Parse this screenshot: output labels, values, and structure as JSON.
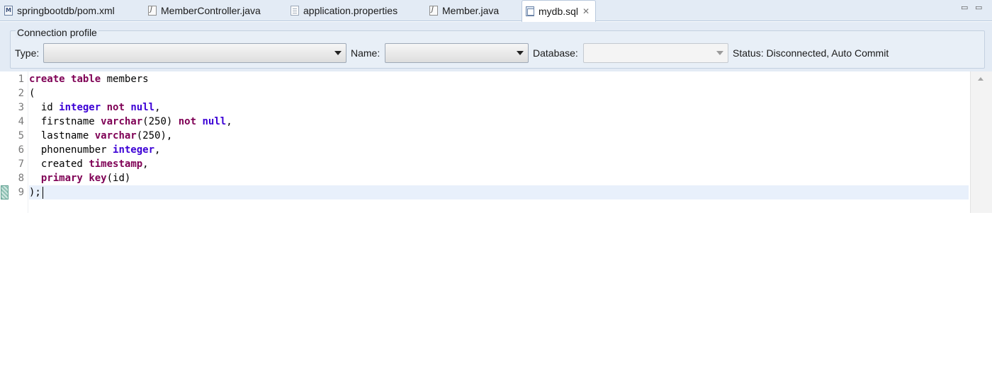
{
  "tabs": [
    {
      "label": "springbootdb/pom.xml",
      "icon": "maven-pom-icon"
    },
    {
      "label": "MemberController.java",
      "icon": "java-file-icon"
    },
    {
      "label": "application.properties",
      "icon": "properties-file-icon"
    },
    {
      "label": "Member.java",
      "icon": "java-file-icon"
    },
    {
      "label": "mydb.sql",
      "icon": "sql-file-icon",
      "active": true,
      "close": "✕"
    }
  ],
  "window_controls": {
    "minimize": "▭",
    "maximize": "▭"
  },
  "connection_profile": {
    "legend": "Connection profile",
    "type_label": "Type:",
    "type_value": "",
    "name_label": "Name:",
    "name_value": "",
    "database_label": "Database:",
    "database_value": "",
    "status": "Status: Disconnected, Auto Commit"
  },
  "editor": {
    "line_numbers": [
      "1",
      "2",
      "3",
      "4",
      "5",
      "6",
      "7",
      "8",
      "9"
    ],
    "lines": [
      "create table members",
      "(",
      "  id integer not null,",
      "  firstname varchar(250) not null,",
      "  lastname varchar(250),",
      "  phonenumber integer,",
      "  created timestamp,",
      "  primary key(id)",
      ");"
    ],
    "current_line": "9"
  },
  "colors": {
    "keyword": "#7f0055",
    "type_keyword": "#3c00d6",
    "tab_bar": "#e3ebf5",
    "current_line_highlight": "#e8f0fb"
  }
}
